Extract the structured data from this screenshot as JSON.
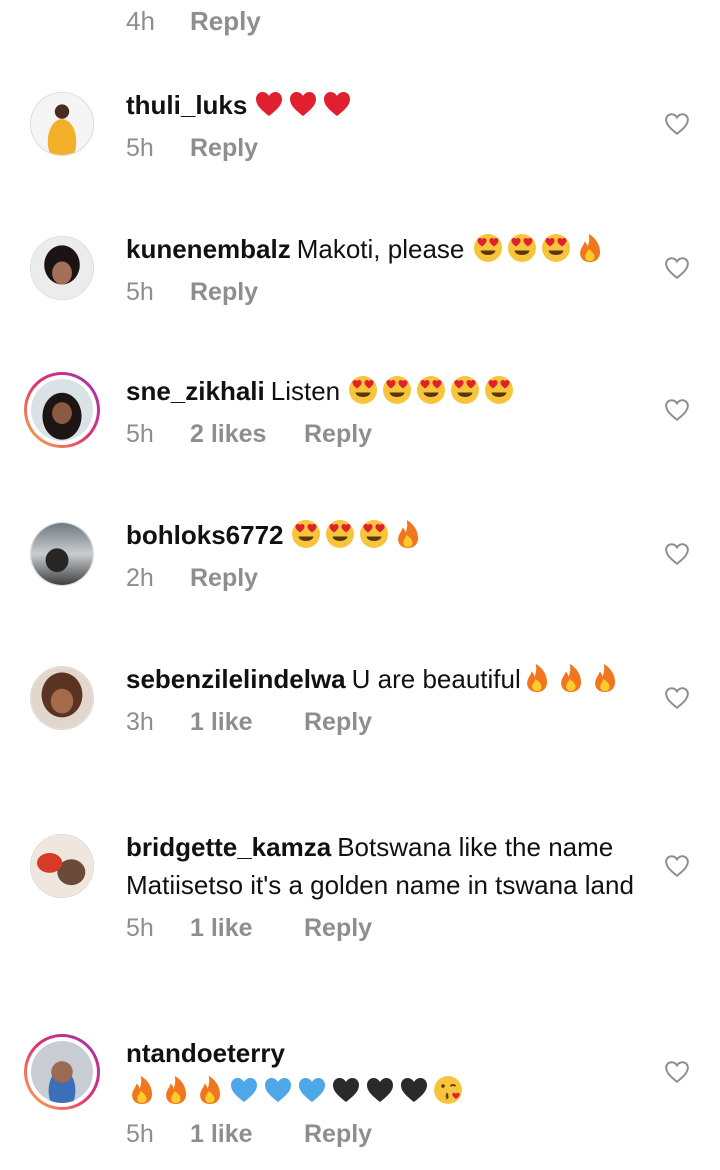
{
  "top": {
    "time": "4h",
    "reply": "Reply"
  },
  "comments": [
    {
      "username": "thuli_luks",
      "text": "",
      "emojis": [
        "heart",
        "heart",
        "heart"
      ],
      "time": "5h",
      "likes": "",
      "reply": "Reply"
    },
    {
      "username": "kunenembalz",
      "text": "Makoti, please",
      "emojis": [
        "heart-eyes",
        "heart-eyes",
        "heart-eyes",
        "fire"
      ],
      "time": "5h",
      "likes": "",
      "reply": "Reply"
    },
    {
      "username": "sne_zikhali",
      "text": "Listen",
      "emojis": [
        "heart-eyes",
        "heart-eyes",
        "heart-eyes",
        "heart-eyes",
        "heart-eyes"
      ],
      "time": "5h",
      "likes": "2 likes",
      "reply": "Reply"
    },
    {
      "username": "bohloks6772",
      "text": "",
      "emojis": [
        "heart-eyes",
        "heart-eyes",
        "heart-eyes",
        "fire"
      ],
      "time": "2h",
      "likes": "",
      "reply": "Reply"
    },
    {
      "username": "sebenzilelindelwa",
      "text": "U are beautiful",
      "emojis": [
        "fire",
        "fire",
        "fire"
      ],
      "time": "3h",
      "likes": "1 like",
      "reply": "Reply"
    },
    {
      "username": "bridgette_kamza",
      "text": "Botswana like the name Matiisetso it's a golden name in tswana land",
      "emojis": [],
      "time": "5h",
      "likes": "1 like",
      "reply": "Reply"
    },
    {
      "username": "ntandoeterry",
      "text": "",
      "emojis": [
        "fire",
        "fire",
        "fire",
        "blue-heart",
        "blue-heart",
        "blue-heart",
        "black-heart",
        "black-heart",
        "black-heart",
        "kiss"
      ],
      "time": "5h",
      "likes": "1 like",
      "reply": "Reply"
    }
  ],
  "colors": {
    "muted": "#8e8e8e",
    "text": "#111111",
    "red_heart": "#e0202f",
    "blue_heart": "#4ea8e8",
    "black_heart": "#2a2a2a",
    "fire": "#f2761d",
    "face": "#f7c53c"
  }
}
